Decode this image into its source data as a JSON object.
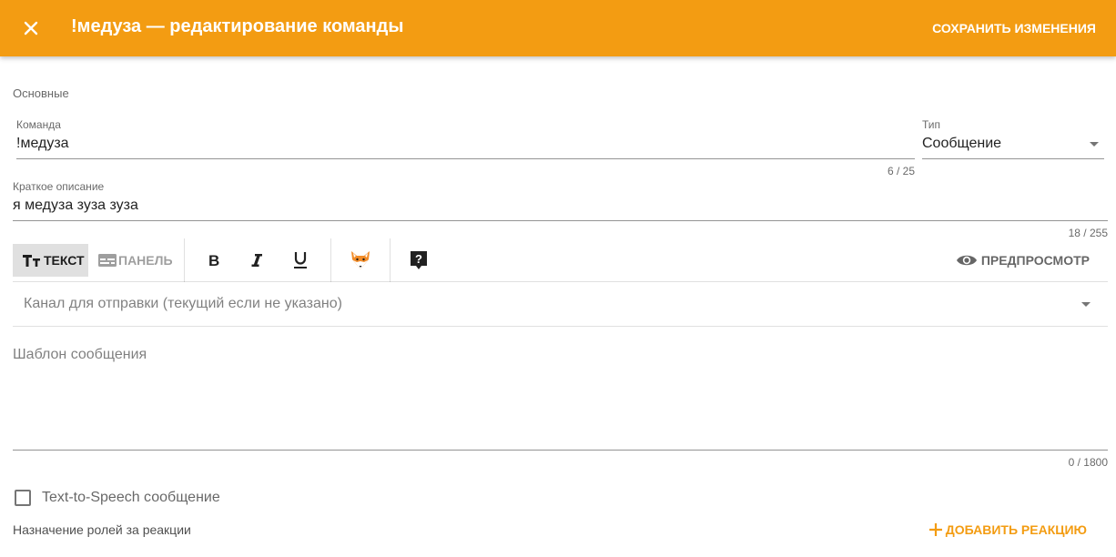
{
  "appbar": {
    "title": "!медуза — редактирование команды",
    "save_label": "СОХРАНИТЬ ИЗМЕНЕНИЯ",
    "close_icon": "close-icon",
    "color": "#f39c12"
  },
  "section": {
    "label": "Основные"
  },
  "command": {
    "label": "Команда",
    "value": "!медуза",
    "counter": "6 / 25"
  },
  "type": {
    "label": "Тип",
    "value": "Сообщение"
  },
  "description": {
    "label": "Краткое описание",
    "value": "я медуза зуза зуза",
    "counter": "18 / 255"
  },
  "toolbar": {
    "text_tab": "ТЕКСТ",
    "panel_tab": "ПАНЕЛЬ",
    "preview_label": "ПРЕДПРОСМОТР",
    "icons": [
      "format-bold-icon",
      "format-italic-icon",
      "format-underline-icon",
      "fox-emoji-icon",
      "help-box-icon"
    ]
  },
  "channel": {
    "placeholder": "Канал для отправки (текущий если не указано)"
  },
  "template": {
    "placeholder": "Шаблон сообщения",
    "counter": "0 / 1800"
  },
  "tts": {
    "label": "Text-to-Speech сообщение",
    "checked": false
  },
  "roles": {
    "label": "Назначение ролей за реакции",
    "add_label": "ДОБАВИТЬ РЕАКЦИЮ"
  }
}
